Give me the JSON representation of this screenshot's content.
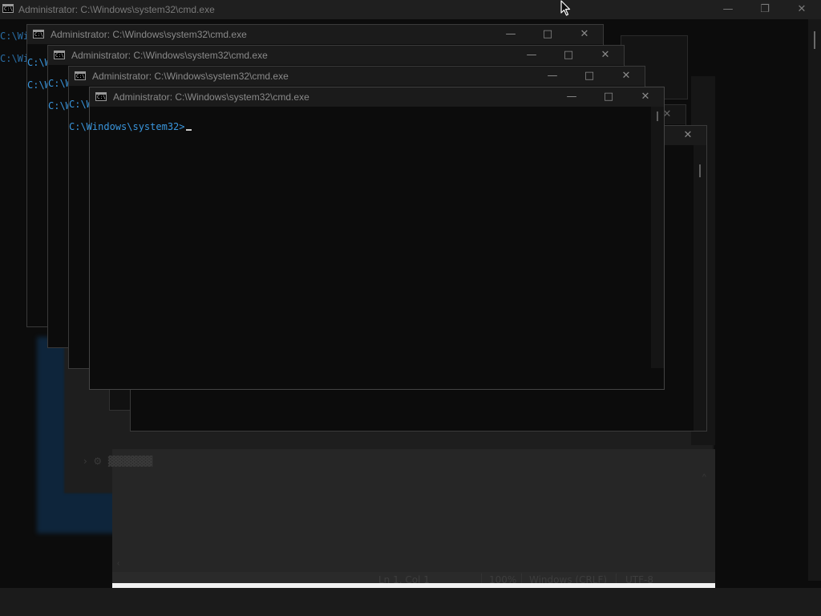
{
  "desktop": {
    "main_window": {
      "title": "Administrator: C:\\Windows\\system32\\cmd.exe",
      "minimize_glyph": "—",
      "maximize_glyph": "❐",
      "close_glyph": "✕",
      "prompt_fragment": "C:\\Wi"
    },
    "cascade_windows": [
      {
        "title": "Administrator: C:\\Windows\\system32\\cmd.exe",
        "prompt_fragment": "C:\\Wi"
      },
      {
        "title": "Administrator: C:\\Windows\\system32\\cmd.exe",
        "prompt_fragment": "C:\\Wi"
      },
      {
        "title": "Administrator: C:\\Windows\\system32\\cmd.exe",
        "prompt_fragment": "C:\\Wi"
      },
      {
        "title": "Administrator: C:\\Windows\\system32\\cmd.exe",
        "prompt": "C:\\Windows\\system32>"
      }
    ],
    "window_controls": {
      "minimize": "—",
      "maximize": "□",
      "close": "✕"
    },
    "icon_glyph": "C:\\",
    "ghost_notepad": {
      "status": {
        "position": "Ln 1, Col 1",
        "zoom": "100%",
        "line_ending": "Windows (CRLF)",
        "encoding": "UTF-8"
      }
    },
    "icons": {
      "cmd": "cmd-prompt-icon",
      "minimize": "minimize-icon",
      "maximize": "maximize-icon",
      "close": "close-icon",
      "pointer": "mouse-pointer-icon"
    },
    "colors": {
      "prompt": "#3a96dd",
      "titlebar": "#1b1b1b",
      "console_bg": "#0c0c0c"
    }
  }
}
